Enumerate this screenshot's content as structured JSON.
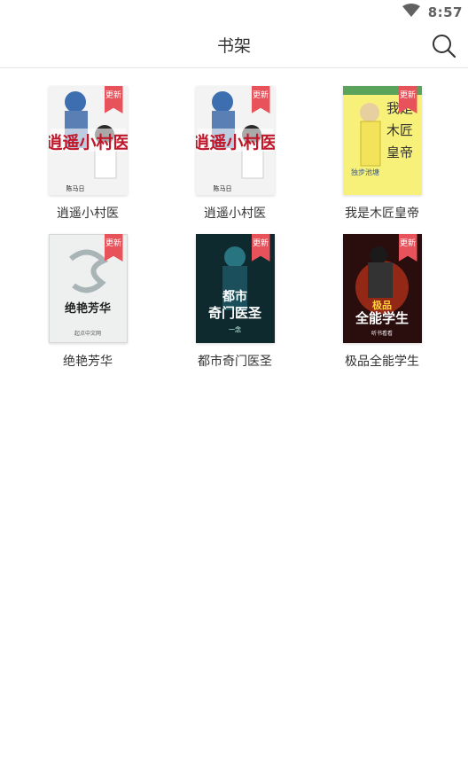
{
  "status": {
    "time": "8:57",
    "wifi_icon": "wifi-icon"
  },
  "appbar": {
    "title": "书架",
    "search_icon": "search-icon"
  },
  "books": [
    {
      "title": "逍遥小村医",
      "badge": "更新",
      "cover_title": "逍遥小村医",
      "cover_author": "陈马日"
    },
    {
      "title": "逍遥小村医",
      "badge": "更新",
      "cover_title": "逍遥小村医",
      "cover_author": "陈马日"
    },
    {
      "title": "我是木匠皇帝",
      "badge": "更新",
      "cover_title": "我是木匠皇帝",
      "cover_author": "独步池塘"
    },
    {
      "title": "绝艳芳华",
      "badge": "更新",
      "cover_title": "绝艳芳华",
      "cover_author": "起点中文网"
    },
    {
      "title": "都市奇门医圣",
      "badge": "更新",
      "cover_title": "都市奇门医圣",
      "cover_author": "一念"
    },
    {
      "title": "极品全能学生",
      "badge": "更新",
      "cover_title": "极品全能学生",
      "cover_author": "听书看看"
    }
  ]
}
